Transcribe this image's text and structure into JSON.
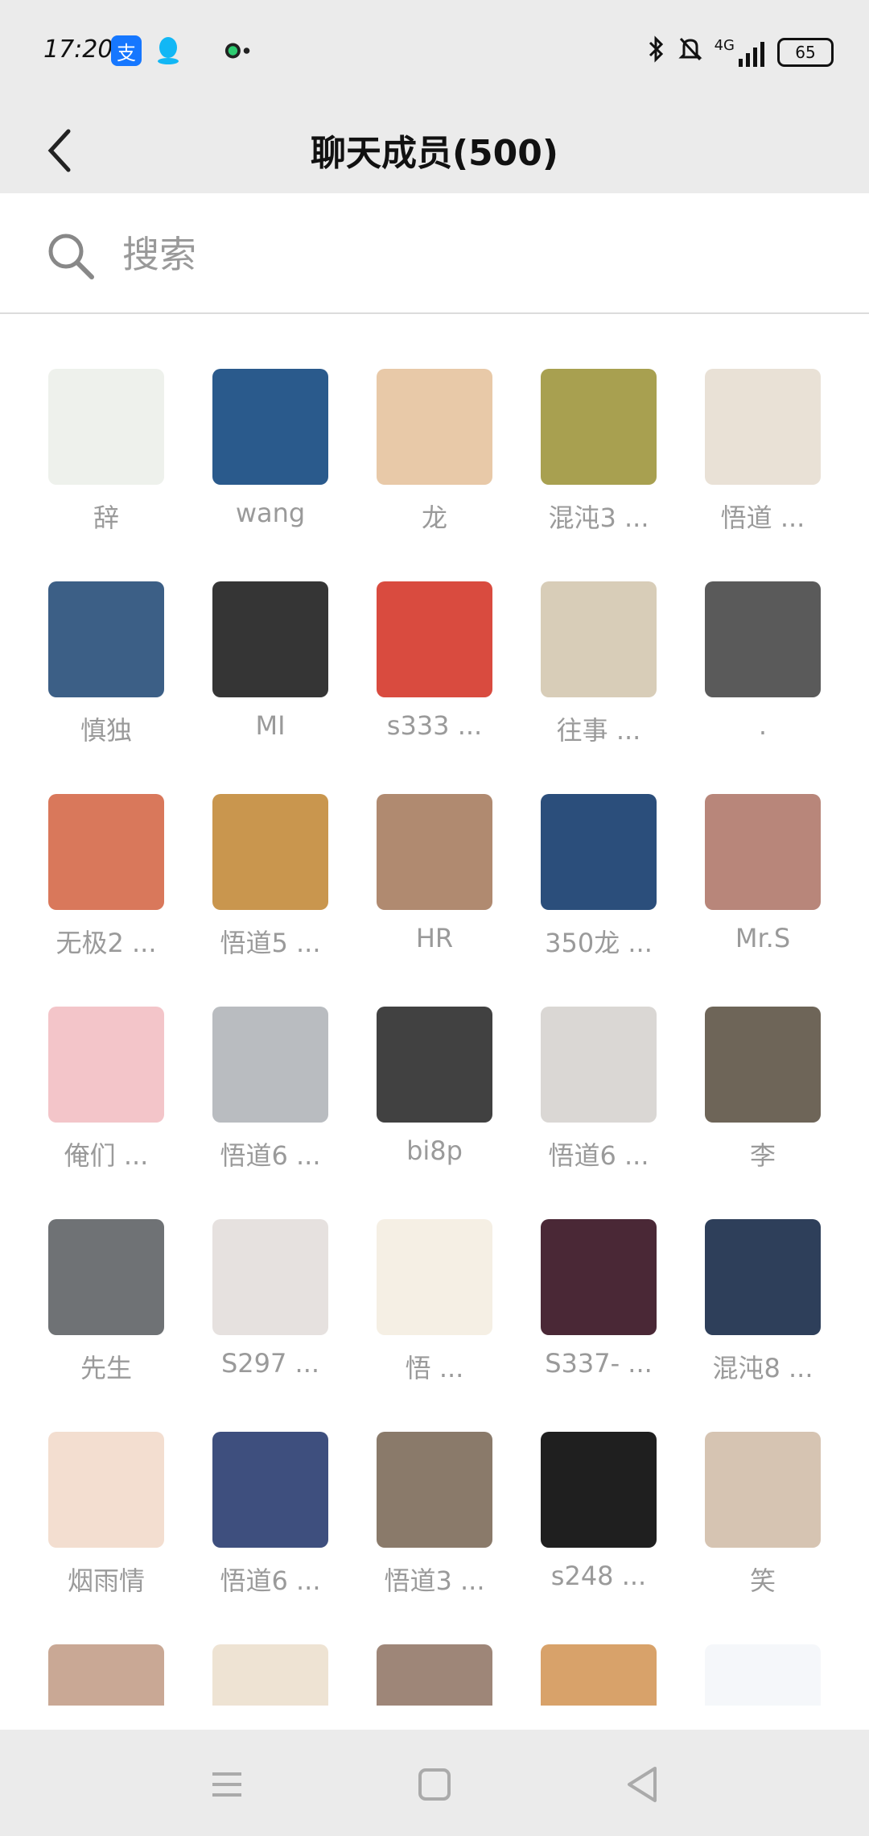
{
  "status_bar": {
    "time": "17:20",
    "network": "4G",
    "battery": "65"
  },
  "header": {
    "title": "聊天成员(500)"
  },
  "search": {
    "placeholder": "搜索"
  },
  "members": [
    {
      "name": "辞",
      "color": "#eef1ec"
    },
    {
      "name": "wang",
      "color": "#2a5a8c"
    },
    {
      "name": "龙",
      "color": "#e8c9a8"
    },
    {
      "name": "混沌3 ...",
      "color": "#a8a050"
    },
    {
      "name": "悟道 ...",
      "color": "#e9e1d6"
    },
    {
      "name": "慎独",
      "color": "#3c5f86"
    },
    {
      "name": "MI",
      "color": "#353535"
    },
    {
      "name": "s333 ...",
      "color": "#d94b3f"
    },
    {
      "name": "往事 ...",
      "color": "#d8cdb8"
    },
    {
      "name": ".",
      "color": "#5a5a5a"
    },
    {
      "name": "无极2 ...",
      "color": "#d9785b"
    },
    {
      "name": "悟道5 ...",
      "color": "#c9964e"
    },
    {
      "name": "HR",
      "color": "#b08a70"
    },
    {
      "name": "350龙 ...",
      "color": "#2b4e7b"
    },
    {
      "name": "Mr.S",
      "color": "#b8867a"
    },
    {
      "name": "俺们 ...",
      "color": "#f3c5c9"
    },
    {
      "name": "悟道6 ...",
      "color": "#b9bcc0"
    },
    {
      "name": "bi8p",
      "color": "#414141"
    },
    {
      "name": "悟道6 ...",
      "color": "#dad7d4"
    },
    {
      "name": "李",
      "color": "#6e6558"
    },
    {
      "name": "先生",
      "color": "#6f7275"
    },
    {
      "name": "S297 ...",
      "color": "#e6e1df"
    },
    {
      "name": "悟 ...",
      "color": "#f5efe4"
    },
    {
      "name": "S337- ...",
      "color": "#4a2836"
    },
    {
      "name": "混沌8 ...",
      "color": "#2e3f5a"
    },
    {
      "name": "烟雨情",
      "color": "#f3ded0"
    },
    {
      "name": "悟道6 ...",
      "color": "#3e4f7e"
    },
    {
      "name": "悟道3 ...",
      "color": "#8a7a6a"
    },
    {
      "name": "s248 ...",
      "color": "#1f1f1f"
    },
    {
      "name": "笑",
      "color": "#d6c4b2"
    },
    {
      "name": "",
      "color": "#c9a895"
    },
    {
      "name": "",
      "color": "#eee3d3"
    },
    {
      "name": "",
      "color": "#9e8678"
    },
    {
      "name": "",
      "color": "#d8a26a"
    },
    {
      "name": "",
      "color": "#f5f7fa"
    }
  ],
  "nav": {
    "menu_icon": "menu-icon",
    "home_icon": "home-icon",
    "back_icon": "back-triangle-icon"
  }
}
